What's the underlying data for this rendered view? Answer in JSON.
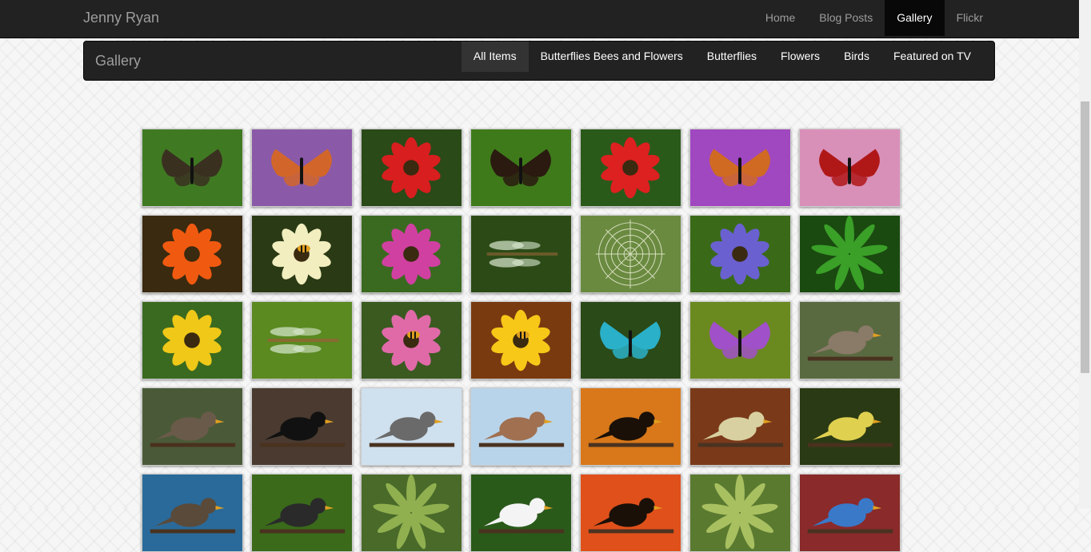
{
  "header": {
    "brand": "Jenny Ryan",
    "nav": [
      {
        "label": "Home",
        "active": false
      },
      {
        "label": "Blog Posts",
        "active": false
      },
      {
        "label": "Gallery",
        "active": true
      },
      {
        "label": "Flickr",
        "active": false
      }
    ]
  },
  "gallery_nav": {
    "title": "Gallery",
    "filters": [
      {
        "label": "All Items",
        "active": true
      },
      {
        "label": "Butterflies Bees and Flowers",
        "active": false
      },
      {
        "label": "Butterflies",
        "active": false
      },
      {
        "label": "Flowers",
        "active": false
      },
      {
        "label": "Birds",
        "active": false
      },
      {
        "label": "Featured on TV",
        "active": false
      }
    ]
  },
  "gallery": {
    "thumbnails": [
      {
        "subject": "butterfly-brown",
        "bg": "#3f7a22",
        "fg": "#3a3020"
      },
      {
        "subject": "butterfly-orange",
        "bg": "#8a5aa8",
        "fg": "#d2662a"
      },
      {
        "subject": "flower-poppy",
        "bg": "#2a4a18",
        "fg": "#d81e1e"
      },
      {
        "subject": "butterfly-red-admiral",
        "bg": "#3e7a1a",
        "fg": "#2a1a10"
      },
      {
        "subject": "flower-poppy",
        "bg": "#2a5a1a",
        "fg": "#dd2020"
      },
      {
        "subject": "butterfly-orange",
        "bg": "#a048c0",
        "fg": "#d06a22"
      },
      {
        "subject": "butterfly-peacock",
        "bg": "#d890b8",
        "fg": "#b01818"
      },
      {
        "subject": "flower-orange",
        "bg": "#3a2a10",
        "fg": "#f05a10"
      },
      {
        "subject": "bee-on-flower",
        "bg": "#2a3a14",
        "fg": "#f2eec0"
      },
      {
        "subject": "flower-pink",
        "bg": "#3a6a20",
        "fg": "#d040a0"
      },
      {
        "subject": "dragonfly",
        "bg": "#2c4a16",
        "fg": "#6a5a2a"
      },
      {
        "subject": "spider-web",
        "bg": "#6a8a40",
        "fg": "#d8e0c0"
      },
      {
        "subject": "flower-bluebell",
        "bg": "#3a6a18",
        "fg": "#6a60d0"
      },
      {
        "subject": "plant-lupin",
        "bg": "#1a4a10",
        "fg": "#3aa028"
      },
      {
        "subject": "flower-yellow-tulip",
        "bg": "#3a6a20",
        "fg": "#f0c818"
      },
      {
        "subject": "dragonfly",
        "bg": "#5a8a20",
        "fg": "#8a6a30"
      },
      {
        "subject": "bee-on-flower",
        "bg": "#3a5a20",
        "fg": "#e06aa8"
      },
      {
        "subject": "bee-on-flower",
        "bg": "#7a3a10",
        "fg": "#f8c818"
      },
      {
        "subject": "butterfly-blue",
        "bg": "#2a4a18",
        "fg": "#2ab0c8"
      },
      {
        "subject": "butterfly-yellow",
        "bg": "#6a8a20",
        "fg": "#a050c8"
      },
      {
        "subject": "bird-hawk",
        "bg": "#5a6a40",
        "fg": "#8a7a68"
      },
      {
        "subject": "bird-hawk",
        "bg": "#4a5a38",
        "fg": "#6a5a4a"
      },
      {
        "subject": "bird-blackbird",
        "bg": "#4a3a30",
        "fg": "#111111"
      },
      {
        "subject": "birds-on-branch",
        "bg": "#cfe0ee",
        "fg": "#6a6a6a"
      },
      {
        "subject": "bird-waxwing",
        "bg": "#b8d4ea",
        "fg": "#a07050"
      },
      {
        "subject": "bird-silhouette",
        "bg": "#d8781a",
        "fg": "#1a1008"
      },
      {
        "subject": "bird-fledgling",
        "bg": "#7a3a1a",
        "fg": "#d8d0a0"
      },
      {
        "subject": "bird-blue-tit",
        "bg": "#2a3a14",
        "fg": "#e0d050"
      },
      {
        "subject": "bird-branch",
        "bg": "#2a6a9a",
        "fg": "#5a4a3a"
      },
      {
        "subject": "bird-green",
        "bg": "#3a6a1a",
        "fg": "#2a2a2a"
      },
      {
        "subject": "plant",
        "bg": "#4a6a2a",
        "fg": "#90b050"
      },
      {
        "subject": "bird-swan",
        "bg": "#2a5a1a",
        "fg": "#f4f4f4"
      },
      {
        "subject": "bird-silhouette",
        "bg": "#e0501a",
        "fg": "#1a1008"
      },
      {
        "subject": "garden",
        "bg": "#5a7a30",
        "fg": "#a8c060"
      },
      {
        "subject": "bird-blue-tit",
        "bg": "#8a2a2a",
        "fg": "#3a78c8"
      }
    ]
  }
}
